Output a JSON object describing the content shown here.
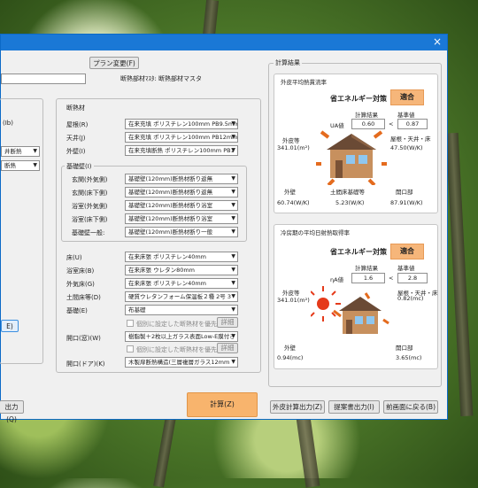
{
  "window": {
    "close_glyph": "×"
  },
  "top": {
    "plan_change_button": "プラン変更(F)",
    "insulation_master_label": "断熱部材ﾏｽﾀ:",
    "insulation_master_value": "断熱部材マスタ",
    "left_combo_value": "度",
    "left_fragment_1": "(Ib)",
    "left_combo2": "井断熱",
    "left_combo3": "断熱"
  },
  "insulation": {
    "group_label": "断熱材",
    "rows": [
      {
        "label": "屋根(R)",
        "value": "在来充填 ポリスチレン100mm PB9.5mm"
      },
      {
        "label": "天井(J)",
        "value": "在来充填 ポリスチレン100mm PB12mm"
      },
      {
        "label": "外壁(I)",
        "value": "在来充填断熱 ポリスチレン100mm PB1"
      }
    ]
  },
  "foundation": {
    "group_label": "基礎壁(I)",
    "rows": [
      {
        "label": "玄関(外気側)",
        "value": "基礎壁(120mm)断熱材断り返無"
      },
      {
        "label": "玄関(床下側)",
        "value": "基礎壁(120mm)断熱材断り返無"
      },
      {
        "label": "浴室(外気側)",
        "value": "基礎壁(120mm)断熱材断り浴室"
      },
      {
        "label": "浴室(床下側)",
        "value": "基礎壁(120mm)断熱材断り浴室"
      },
      {
        "label": "基礎壁一般:",
        "value": "基礎壁(120mm)断熱材断り一般"
      }
    ]
  },
  "lower_rows": [
    {
      "label": "床(U)",
      "value": "在来床張 ポリスチレン40mm"
    },
    {
      "label": "浴室床(B)",
      "value": "在来床張 ウレタン80mm"
    },
    {
      "label": "外気床(G)",
      "value": "在来床張 ポリスチレン40mm"
    },
    {
      "label": "土間床等(D)",
      "value": "硬質ウレタンフォーム保温板２種 2号 3"
    },
    {
      "label": "基礎(E)",
      "value": "布基礎"
    }
  ],
  "check1": "個別に設定した断熱材を優先",
  "check1_btn": "詳細",
  "opening_up": {
    "label": "開口(窓)(W)",
    "value": "樹脂製＋2枚以上ガラス表面Low-E膜付き"
  },
  "check2": "個別に設定した断熱材を優先",
  "check2_btn": "詳細",
  "opening_door": {
    "label": "開口(ドア)(K)",
    "value": "木製扉断熱構造(三層複層ガラス12mm"
  },
  "left_buttons": {
    "btn_e": "E)",
    "bottom_left": "出力(Q)"
  },
  "calc_button": "計算(Z)",
  "result": {
    "group_label": "計算結果",
    "panel1": {
      "title": "外皮平均熱貫流率",
      "policy": "省エネルギー対策",
      "judge": "適合",
      "calc_label": "計算結果",
      "std_label": "基準値",
      "ua_label": "UA値",
      "ua_value": "0.60",
      "compare": "<",
      "ua_std": "0.87",
      "area_label": "外皮等",
      "area_value": "341.01(m²)",
      "roof_label": "屋根・天井・床",
      "roof_value": "47.50(W/K)",
      "wall_label": "外壁",
      "wall_value": "60.74(W/K)",
      "earth_label": "土間床基礎等",
      "earth_value": "5.23(W/K)",
      "open_label": "開口部",
      "open_value": "87.91(W/K)"
    },
    "panel2": {
      "title": "冷房期の平均日射熱取得率",
      "policy": "省エネルギー対策",
      "judge": "適合",
      "calc_label": "計算結果",
      "std_label": "基準値",
      "eta_label": "ηA値",
      "eta_value": "1.6",
      "compare": "<",
      "eta_std": "2.8",
      "area_label": "外皮等",
      "area_value": "341.01(m²)",
      "roof_label": "屋根・天井・床",
      "roof_value": "0.82(mc)",
      "wall_label": "外壁",
      "wall_value": "0.94(mc)",
      "open_label": "開口部",
      "open_value": "3.65(mc)"
    }
  },
  "bottom_buttons": {
    "skin_output": "外皮計算出力(Z)",
    "report_output": "提案書出力(I)",
    "back": "前画面に戻る(B)"
  },
  "colors": {
    "accent": "#1a78d6",
    "badge": "#f6b67a",
    "house_wall": "#c7905e",
    "arrow": "#e46b1e"
  }
}
